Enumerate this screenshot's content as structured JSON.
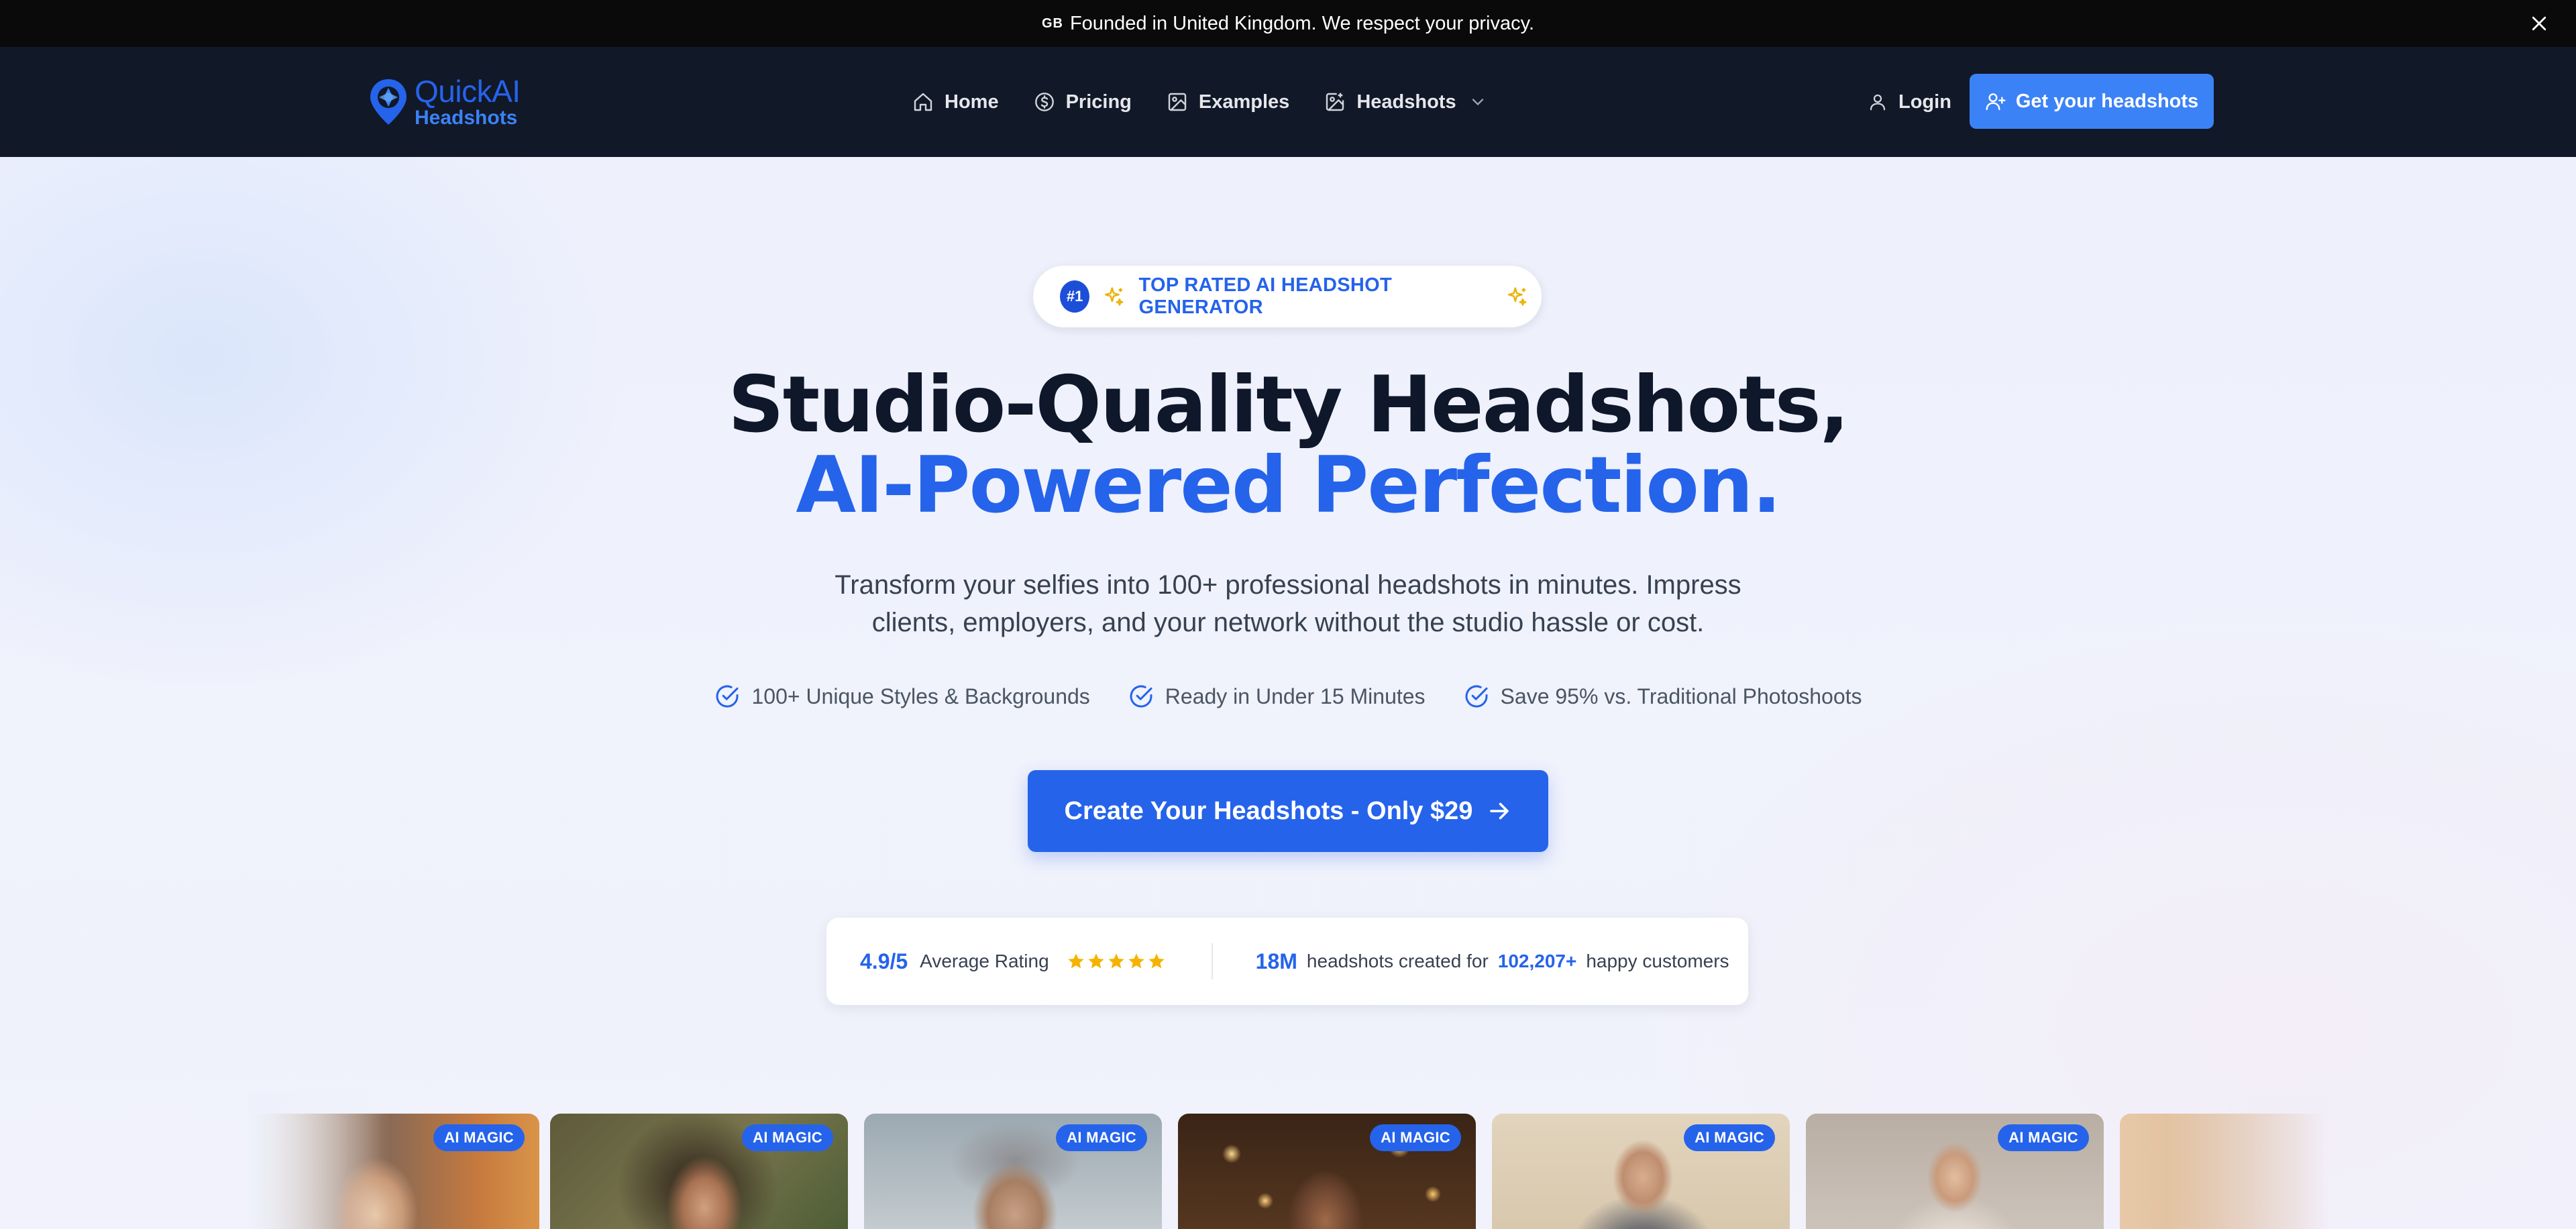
{
  "banner": {
    "flag": "GB",
    "text": "Founded in United Kingdom. We respect your privacy."
  },
  "logo": {
    "line1": "QuickAI",
    "line2": "Headshots"
  },
  "nav": {
    "items": [
      {
        "label": "Home",
        "icon": "home-icon"
      },
      {
        "label": "Pricing",
        "icon": "dollar-circle-icon"
      },
      {
        "label": "Examples",
        "icon": "image-icon"
      },
      {
        "label": "Headshots",
        "icon": "image-sparkle-icon"
      }
    ],
    "login": "Login",
    "cta": "Get your headshots"
  },
  "hero": {
    "badge_num": "#1",
    "badge_text": "TOP RATED AI HEADSHOT GENERATOR",
    "title_line1": "Studio-Quality Headshots,",
    "title_line2": "AI-Powered Perfection.",
    "subtitle_line1": "Transform your selfies into 100+ professional headshots in minutes. Impress",
    "subtitle_line2": "clients, employers, and your network without the studio hassle or cost.",
    "features": [
      "100+ Unique Styles & Backgrounds",
      "Ready in Under 15 Minutes",
      "Save 95% vs. Traditional Photoshoots"
    ],
    "cta": "Create Your Headshots - Only $29"
  },
  "stats": {
    "rating": "4.9/5",
    "rating_label": "Average Rating",
    "stars": 5,
    "count": "18M",
    "count_label": "headshots created for",
    "customers": "102,207+",
    "customers_label": "happy customers"
  },
  "gallery": {
    "tag": "AI MAGIC",
    "cards": 7
  },
  "colors": {
    "brand": "#2563eb",
    "nav_bg": "#111827",
    "banner_bg": "#0a0a0a",
    "star": "#f5b301"
  }
}
